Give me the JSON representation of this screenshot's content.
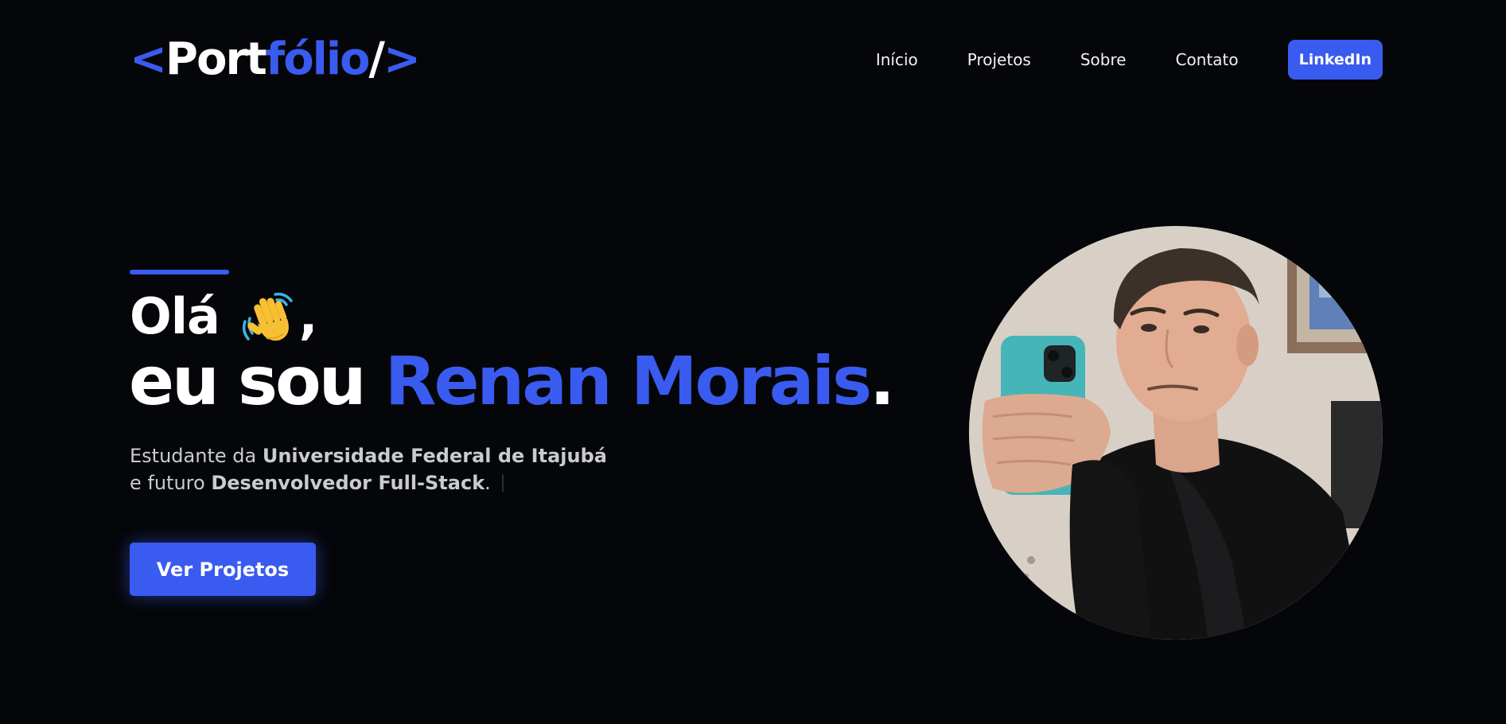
{
  "logo": {
    "open_bracket": "<",
    "main": "Port",
    "accent": "fólio",
    "slash": "/",
    "close_bracket": ">"
  },
  "nav": {
    "items": [
      {
        "label": "Início"
      },
      {
        "label": "Projetos"
      },
      {
        "label": "Sobre"
      },
      {
        "label": "Contato"
      }
    ],
    "cta_label": "LinkedIn"
  },
  "hero": {
    "greeting": "Olá",
    "greeting_icon": "waving-hand-icon",
    "greeting_comma": ",",
    "headline_prefix": "eu sou ",
    "name": "Renan Morais",
    "headline_suffix": ".",
    "subtitle_line1_prefix": "Estudante da ",
    "subtitle_line1_bold": "Universidade Federal de Itajubá",
    "subtitle_line2_prefix": "e futuro ",
    "subtitle_line2_bold": "Desenvolvedor Full-Stack",
    "subtitle_line2_suffix": ".",
    "cta_label": "Ver Projetos"
  },
  "colors": {
    "background": "#050609",
    "accent": "#3a5bf0",
    "text": "#ffffff",
    "muted_text": "#c9cbd1"
  }
}
